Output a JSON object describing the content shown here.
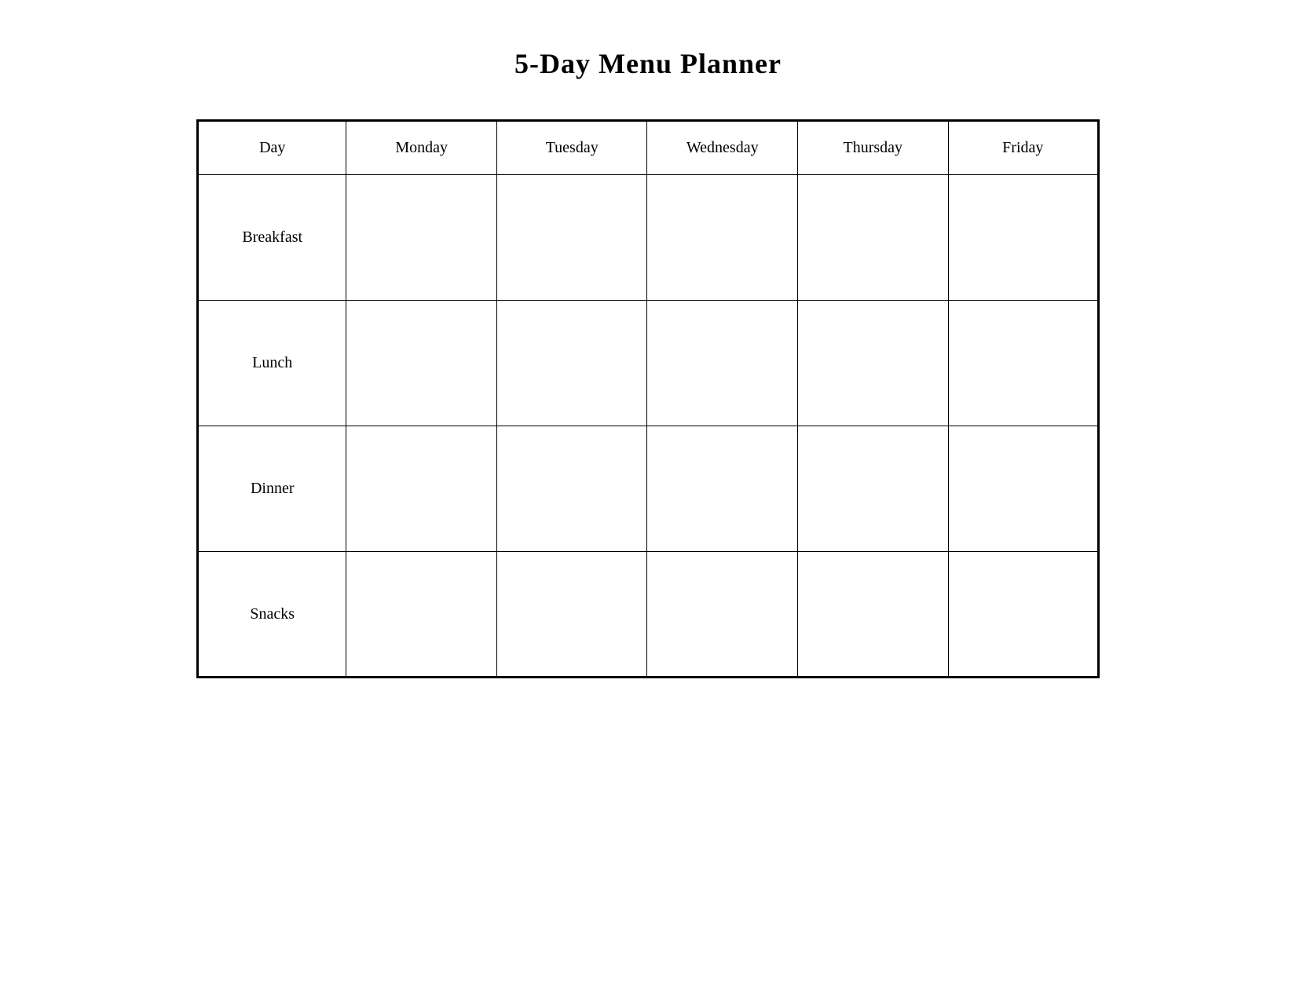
{
  "title": "5-Day Menu Planner",
  "header": {
    "col_day": "Day",
    "col_monday": "Monday",
    "col_tuesday": "Tuesday",
    "col_wednesday": "Wednesday",
    "col_thursday": "Thursday",
    "col_friday": "Friday"
  },
  "rows": [
    {
      "label": "Breakfast"
    },
    {
      "label": "Lunch"
    },
    {
      "label": "Dinner"
    },
    {
      "label": "Snacks"
    }
  ]
}
